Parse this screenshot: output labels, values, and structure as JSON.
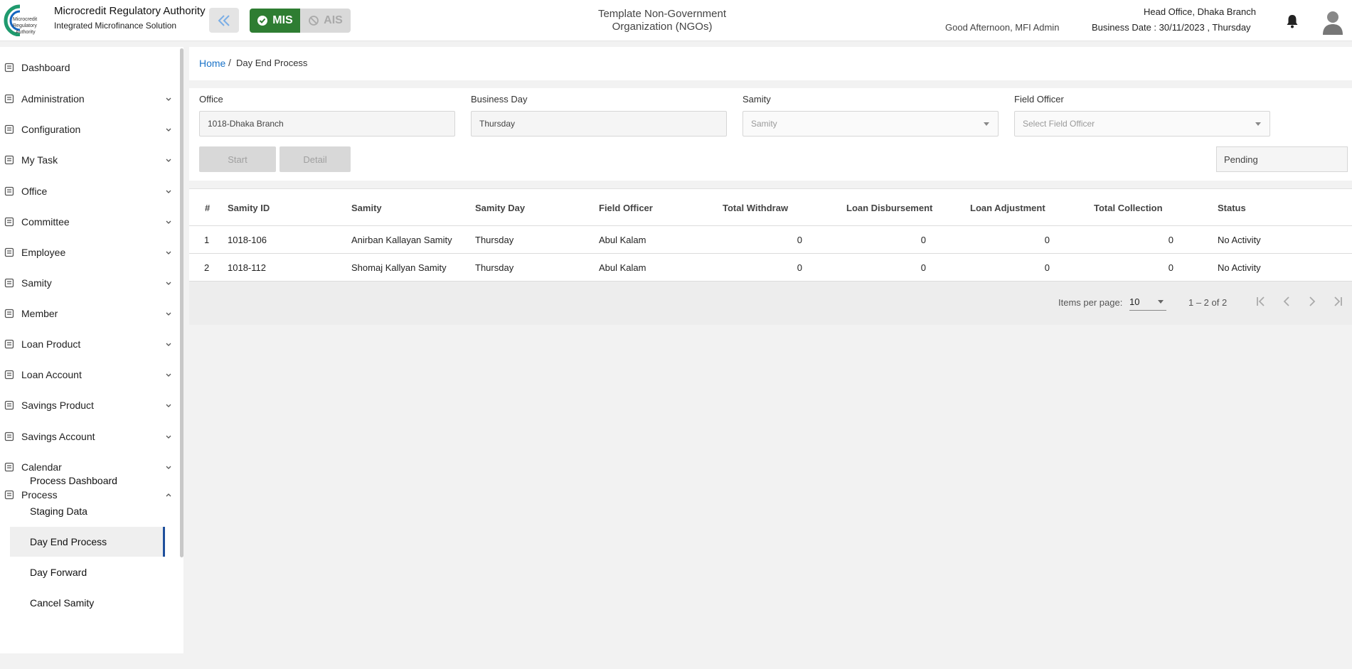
{
  "header": {
    "brand_title": "Microcredit Regulatory Authority",
    "brand_subtitle": "Integrated Microfinance Solution",
    "logo_text_line1": "Microcredit",
    "logo_text_line2": "Regulatory",
    "logo_text_line3": "Authority",
    "mode_mis": "MIS",
    "mode_ais": "AIS",
    "org_title_line1": "Template Non-Government",
    "org_title_line2": "Organization (NGOs)",
    "greeting": "Good Afternoon, MFI Admin",
    "branch": "Head Office, Dhaka Branch",
    "business_date": "Business Date : 30/11/2023 , Thursday",
    "accent": "#2e7d32"
  },
  "sidebar": {
    "items": [
      {
        "label": "Dashboard",
        "icon": "dashboard-icon"
      },
      {
        "label": "Administration",
        "icon": "admin-icon"
      },
      {
        "label": "Configuration",
        "icon": "sliders-icon"
      },
      {
        "label": "My Task",
        "icon": "task-icon"
      },
      {
        "label": "Office",
        "icon": "office-icon"
      },
      {
        "label": "Committee",
        "icon": "committee-icon"
      },
      {
        "label": "Employee",
        "icon": "employee-icon"
      },
      {
        "label": "Samity",
        "icon": "samity-icon"
      },
      {
        "label": "Member",
        "icon": "member-icon"
      },
      {
        "label": "Loan Product",
        "icon": "loan-product-icon"
      },
      {
        "label": "Loan Account",
        "icon": "loan-account-icon"
      },
      {
        "label": "Savings Product",
        "icon": "savings-product-icon"
      },
      {
        "label": "Savings Account",
        "icon": "savings-account-icon"
      },
      {
        "label": "Calendar",
        "icon": "calendar-icon"
      },
      {
        "label": "Process",
        "icon": "process-icon"
      }
    ],
    "process_sub": [
      "Process Dashboard",
      "Staging Data",
      "Day End Process",
      "Day Forward",
      "Cancel Samity"
    ],
    "active_sub": "Day End Process"
  },
  "breadcrumb": {
    "home": "Home",
    "separator": "/",
    "current": "Day End Process"
  },
  "form": {
    "office_label": "Office",
    "office_value": "1018-Dhaka Branch",
    "business_day_label": "Business Day",
    "business_day_value": "Thursday",
    "samity_label": "Samity",
    "samity_placeholder": "Samity",
    "field_officer_label": "Field Officer",
    "field_officer_placeholder": "Select Field Officer",
    "start_button": "Start",
    "detail_button": "Detail",
    "status_value": "Pending"
  },
  "table": {
    "headers": [
      "#",
      "Samity ID",
      "Samity",
      "Samity Day",
      "Field Officer",
      "Total Withdraw",
      "Loan Disbursement",
      "Loan Adjustment",
      "Total Collection",
      "Status"
    ],
    "rows": [
      [
        "1",
        "1018-106",
        "Anirban Kallayan Samity",
        "Thursday",
        "Abul Kalam",
        "0",
        "0",
        "0",
        "0",
        "No Activity"
      ],
      [
        "2",
        "1018-112",
        "Shomaj Kallyan Samity",
        "Thursday",
        "Abul Kalam",
        "0",
        "0",
        "0",
        "0",
        "No Activity"
      ]
    ]
  },
  "paginator": {
    "items_per_page_label": "Items per page:",
    "page_size": "10",
    "range": "1 – 2 of 2"
  }
}
